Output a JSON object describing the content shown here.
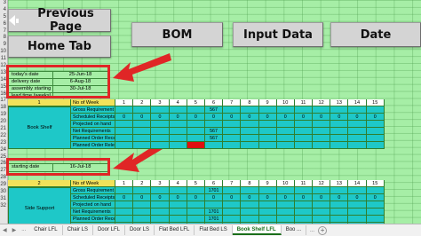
{
  "row_numbers": [
    "3",
    "4",
    "5",
    "6",
    "7",
    "8",
    "9",
    "10",
    "11",
    "12",
    "13",
    "14",
    "15",
    "16",
    "17",
    "18",
    "19",
    "20",
    "21",
    "22",
    "23",
    "24",
    "25",
    "26",
    "27",
    "28",
    "29",
    "30",
    "31",
    "32"
  ],
  "buttons": {
    "previous_page": "Previous Page",
    "home_tab": "Home Tab",
    "bom": "BOM",
    "input_data": "Input Data",
    "date": "Date"
  },
  "info": {
    "rows": [
      {
        "label": "today's date",
        "value": "25-Jun-18"
      },
      {
        "label": "delivery date",
        "value": "6-Aug-18"
      },
      {
        "label": "assembly starting",
        "value": "30-Jul-18"
      },
      {
        "label": "lead time (weeks)",
        "value": ""
      }
    ]
  },
  "start": {
    "label": "starting date",
    "value": "16-Jul-18"
  },
  "header1": {
    "code": "1",
    "week_label": "No of Week",
    "weeks": [
      "1",
      "2",
      "3",
      "4",
      "5",
      "6",
      "7",
      "8",
      "9",
      "10",
      "11",
      "12",
      "13",
      "14",
      "15"
    ]
  },
  "header2": {
    "code": "2",
    "week_label": "No of Week",
    "weeks": [
      "1",
      "2",
      "3",
      "4",
      "5",
      "6",
      "7",
      "8",
      "9",
      "10",
      "11",
      "12",
      "13",
      "14",
      "15"
    ]
  },
  "block1": {
    "item": "Book Shelf",
    "labels": [
      "Gross Requirement",
      "Scheduled Receipts",
      "Projected on hand",
      "Net Requirements",
      "Planned Order Receipts",
      "Planned Order Releases"
    ],
    "rows": [
      [
        "",
        "",
        "",
        "",
        "",
        "567",
        "",
        "",
        "",
        "",
        "",
        "",
        "",
        "",
        ""
      ],
      [
        "0",
        "0",
        "0",
        "0",
        "0",
        "0",
        "0",
        "0",
        "0",
        "0",
        "0",
        "0",
        "0",
        "0",
        "0"
      ],
      [
        "",
        "",
        "",
        "",
        "",
        "",
        "",
        "",
        "",
        "",
        "",
        "",
        "",
        "",
        ""
      ],
      [
        "",
        "",
        "",
        "",
        "",
        "567",
        "",
        "",
        "",
        "",
        "",
        "",
        "",
        "",
        ""
      ],
      [
        "",
        "",
        "",
        "",
        "",
        "567",
        "",
        "",
        "",
        "",
        "",
        "",
        "",
        "",
        ""
      ],
      [
        "",
        "",
        "",
        "",
        "",
        "",
        "",
        "",
        "",
        "",
        "",
        "",
        "",
        "",
        ""
      ]
    ]
  },
  "block2": {
    "item": "Side Support",
    "labels": [
      "Gross Requirement",
      "Scheduled Receipts",
      "Projected on hand",
      "Net Requirements",
      "Planned Order Receipts",
      "Planned Order Releases"
    ],
    "rows": [
      [
        "",
        "",
        "",
        "",
        "",
        "1701",
        "",
        "",
        "",
        "",
        "",
        "",
        "",
        "",
        ""
      ],
      [
        "0",
        "0",
        "0",
        "0",
        "0",
        "0",
        "0",
        "0",
        "0",
        "0",
        "0",
        "0",
        "0",
        "0",
        "0"
      ],
      [
        "",
        "",
        "",
        "",
        "",
        "",
        "",
        "",
        "",
        "",
        "",
        "",
        "",
        "",
        ""
      ],
      [
        "",
        "",
        "",
        "",
        "",
        "1701",
        "",
        "",
        "",
        "",
        "",
        "",
        "",
        "",
        ""
      ],
      [
        "",
        "",
        "",
        "",
        "",
        "1701",
        "",
        "",
        "",
        "",
        "",
        "",
        "",
        "",
        ""
      ],
      [
        "",
        "",
        "",
        "",
        "",
        "",
        "",
        "",
        "",
        "",
        "",
        "",
        "",
        "",
        ""
      ]
    ]
  },
  "tabs": {
    "items": [
      "Chair LFL",
      "Chair LS",
      "Door LFL",
      "Door LS",
      "Flat Bed LFL",
      "Flat Bed LS",
      "Book Shelf LFL",
      "Boo ..."
    ],
    "active_index": 6,
    "nav_ellipsis": "..."
  },
  "colors": {
    "sheet_bg": "#a6eea6",
    "teal": "#1ec8c8",
    "highlight_red": "#e01010",
    "annotation_red": "#e02626"
  }
}
